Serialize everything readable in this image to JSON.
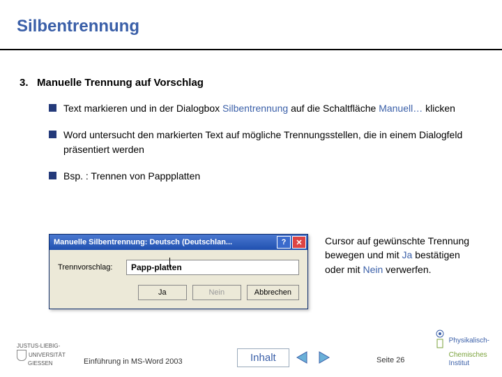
{
  "title": "Silbentrennung",
  "sectionNumber": "3.",
  "sectionLabel": "Manuelle Trennung auf Vorschlag",
  "bullets": {
    "b1_pre": "Text markieren und in der Dialogbox ",
    "b1_hl1": "Silbentrennung",
    "b1_mid": " auf die Schaltfläche ",
    "b1_hl2": "Manuell…",
    "b1_post": " klicken",
    "b2": "Word untersucht den markierten Text auf mögliche Trennungsstellen, die in einem Dialogfeld präsentiert werden",
    "b3": "Bsp. : Trennen von Pappplatten"
  },
  "dialog": {
    "title": "Manuelle Silbentrennung: Deutsch (Deutschlan...",
    "label": "Trennvorschlag:",
    "word_part1": "Papp-plat",
    "word_part2": "ten",
    "yes": "Ja",
    "no": "Nein",
    "cancel": "Abbrechen",
    "help": "?",
    "close": "✕"
  },
  "afterText": {
    "pre": "Cursor auf gewünschte Trennung bewegen und mit ",
    "yes": "Ja",
    "mid": " bestätigen oder mit ",
    "no": "Nein",
    "post": " verwerfen."
  },
  "footer": {
    "uni1": "JUSTUS-LIEBIG-",
    "uni2": "UNIVERSITÄT",
    "uni3": "GIESSEN",
    "source": "Einführung in MS-Word 2003",
    "inhalt": "Inhalt",
    "page": "Seite 26",
    "inst1": "Physikalisch-",
    "inst2": "Chemisches",
    "inst3": "Institut"
  }
}
